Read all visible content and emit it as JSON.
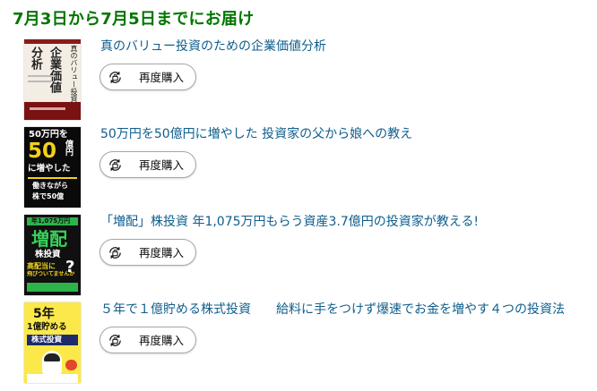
{
  "delivery_heading": "7月3日から7月5日までにお届け",
  "rebuy_label": "再度購入",
  "rebuy_icon": "rebuy-bag-icon",
  "colors": {
    "heading": "#007600",
    "link": "#0f5e8c",
    "button_border": "#a2a6ac"
  },
  "items": [
    {
      "title": "真のバリュー投資のための企業価値分析",
      "cover": {
        "c1": "真のバリュー投資",
        "c2": "企業価値",
        "c3": "分析"
      }
    },
    {
      "title": "50万円を50億円に増やした 投資家の父から娘への教え",
      "cover": {
        "c1": "50万円を",
        "c2": "50",
        "c3": "億円",
        "c4": "に増やした",
        "c5": "働きながら",
        "c6": "株で50億"
      }
    },
    {
      "title": "「増配」株投資 年1,075万円もらう資産3.7億円の投資家が教える!",
      "cover": {
        "c1": "年1,075万円",
        "c2": "増配",
        "c3": "株投資",
        "c4": "高配当に",
        "c5": "飛びついてませんか",
        "c6": "?"
      }
    },
    {
      "title": "５年で１億貯める株式投資　　給料に手をつけず爆速でお金を増やす４つの投資法",
      "cover": {
        "c1": "5年",
        "c2": "1億貯める",
        "c3": "株式投資"
      }
    }
  ]
}
